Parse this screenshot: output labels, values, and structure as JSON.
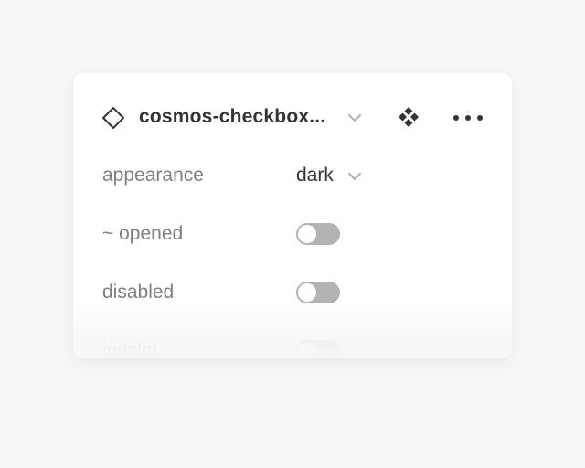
{
  "header": {
    "component_icon": "diamond-outline-icon",
    "component_name": "cosmos-checkbox...",
    "name_dropdown_icon": "chevron-down-icon",
    "variant_icon": "component-set-icon",
    "more_icon": "more-horizontal-icon"
  },
  "properties": [
    {
      "label": "appearance",
      "type": "select",
      "value": "dark"
    },
    {
      "label": "~ opened",
      "type": "toggle",
      "on": false
    },
    {
      "label": "disabled",
      "type": "toggle",
      "on": false
    },
    {
      "label": "invalid",
      "type": "toggle",
      "on": false
    }
  ],
  "colors": {
    "background": "#f7f7f7",
    "panel": "#ffffff",
    "label_text": "#7f7f7f",
    "value_text": "#333333",
    "toggle_off": "#b3b3b3"
  }
}
